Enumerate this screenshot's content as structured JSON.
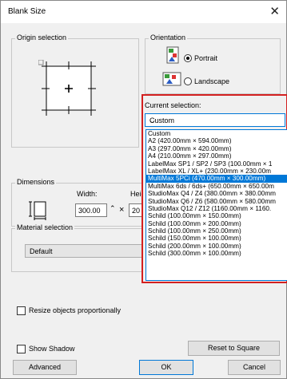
{
  "window": {
    "title": "Blank Size",
    "close_glyph": "✕"
  },
  "origin": {
    "legend": "Origin selection"
  },
  "orientation": {
    "legend": "Orientation",
    "portrait_label": "Portrait",
    "landscape_label": "Landscape",
    "selected": "Portrait"
  },
  "dimensions": {
    "legend": "Dimensions",
    "width_label": "Width:",
    "height_label": "Heig",
    "width_value": "300.00",
    "height_value": "20",
    "times": "×"
  },
  "material": {
    "legend": "Material selection",
    "value": "Default"
  },
  "current": {
    "label": "Current selection:",
    "value": "Custom",
    "items": [
      "Custom",
      "A2  (420.00mm × 594.00mm)",
      "A3  (297.00mm × 420.00mm)",
      "A4  (210.00mm × 297.00mm)",
      "LabelMax SP1 / SP2 / SP3  (100.00mm × 1",
      "LabelMax XL / XL+  (230.00mm × 230.00m",
      "MultiMax 5PCi  (470.00mm × 300.00mm)",
      "MultiMax 6ds / 6ds+  (650.00mm × 650.00m",
      "StudioMax Q4 / Z4  (380.00mm × 380.00mm",
      "StudioMax Q6 / Z6  (580.00mm × 580.00mm",
      "StudioMax Q12 / Z12  (1160.00mm × 1160.",
      "Schild  (100.00mm × 150.00mm)",
      "Schild  (100.00mm × 200.00mm)",
      "Schild  (100.00mm × 250.00mm)",
      "Schild  (150.00mm × 100.00mm)",
      "Schild  (200.00mm × 100.00mm)",
      "Schild  (300.00mm × 100.00mm)"
    ],
    "selected_item": "MultiMax 5PCi  (470.00mm × 300.00mm)"
  },
  "options": {
    "resize_label": "Resize objects proportionally",
    "shadow_label": "Show Shadow"
  },
  "buttons": {
    "reset": "Reset to Square",
    "advanced": "Advanced",
    "ok": "OK",
    "cancel": "Cancel"
  },
  "colors": {
    "accent": "#0078d7",
    "highlight_border": "#d32020"
  }
}
